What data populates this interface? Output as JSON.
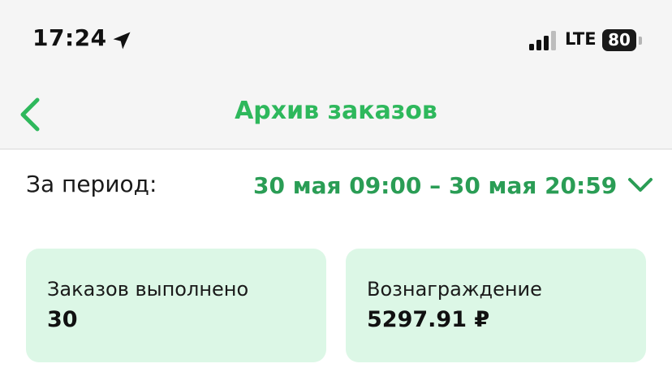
{
  "status_bar": {
    "time": "17:24",
    "network": "LTE",
    "battery": "80"
  },
  "nav": {
    "title": "Архив заказов"
  },
  "period": {
    "label": "За период:",
    "value": "30 мая 09:00 – 30 мая 20:59"
  },
  "cards": [
    {
      "label": "Заказов выполнено",
      "value": "30"
    },
    {
      "label": "Вознаграждение",
      "value": "5297.91 ₽"
    }
  ],
  "colors": {
    "accent": "#2eb85c",
    "card_bg": "#dcf7e6",
    "header_bg": "#f5f5f5"
  },
  "icons": [
    "location-arrow-icon",
    "signal-bars-icon",
    "battery-icon",
    "chevron-left-icon",
    "chevron-down-icon"
  ]
}
